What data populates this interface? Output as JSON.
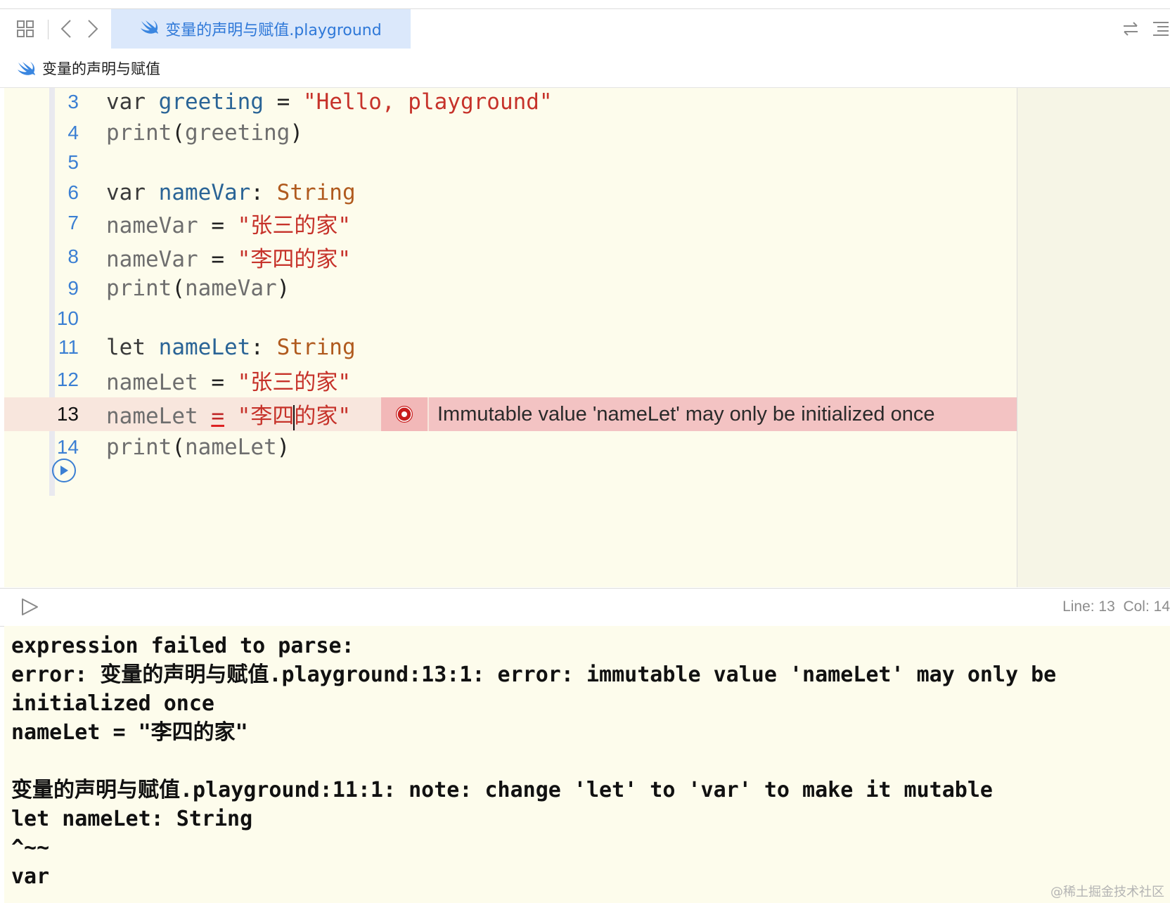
{
  "tab": {
    "title": "变量的声明与赋值.playground"
  },
  "breadcrumb": {
    "label": "变量的声明与赋值"
  },
  "editor": {
    "lines": [
      {
        "number": "3"
      },
      {
        "number": "4"
      },
      {
        "number": "5"
      },
      {
        "number": "6"
      },
      {
        "number": "7"
      },
      {
        "number": "8"
      },
      {
        "number": "9"
      },
      {
        "number": "10"
      },
      {
        "number": "11"
      },
      {
        "number": "12"
      },
      {
        "number": "13"
      },
      {
        "number": "14"
      }
    ],
    "tokens": {
      "var": "var",
      "let": "let",
      "print": "print",
      "greeting": "greeting",
      "hello": "\"Hello, playground\"",
      "nameVar": "nameVar",
      "nameLet": "nameLet",
      "String": "String",
      "zhangsan": "\"张三的家\"",
      "lisi_a": "\"李四",
      "lisi_b": "的家\"",
      "lisi": "\"李四的家\""
    },
    "error_message": "Immutable value 'nameLet' may only be initialized once"
  },
  "status": {
    "position": "Line: 13  Col: 14"
  },
  "console": {
    "output": "expression failed to parse:\nerror: 变量的声明与赋值.playground:13:1: error: immutable value 'nameLet' may only be\ninitialized once\nnameLet = \"李四的家\"\n\n变量的声明与赋值.playground:11:1: note: change 'let' to 'var' to make it mutable\nlet nameLet: String\n^~~\nvar"
  },
  "watermark": "@稀土掘金技术社区",
  "colors": {
    "accent": "#2e78d8",
    "error": "#c6322a",
    "editor_bg": "#fdfcec"
  },
  "icons": [
    "grid-icon",
    "back-icon",
    "forward-icon",
    "swift-icon",
    "swap-icon",
    "list-icon",
    "error-icon",
    "run-icon",
    "play-icon"
  ]
}
